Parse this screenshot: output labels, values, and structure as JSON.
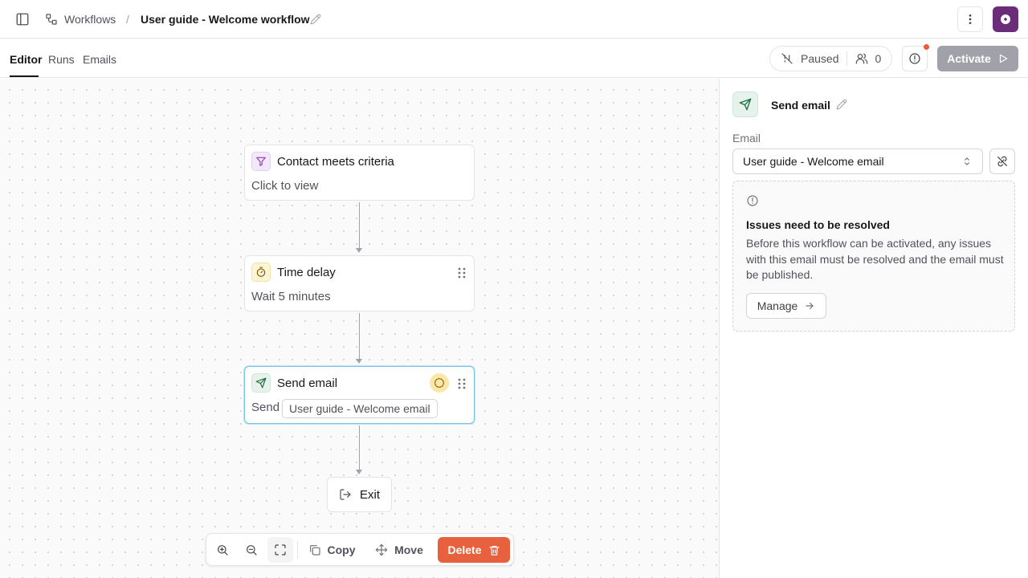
{
  "header": {
    "breadcrumb_root": "Workflows",
    "separator": "/",
    "workflow_name": "User guide - Welcome workflow"
  },
  "tabs": [
    {
      "label": "Editor",
      "active": true
    },
    {
      "label": "Runs",
      "active": false
    },
    {
      "label": "Emails",
      "active": false
    }
  ],
  "status": {
    "state_label": "Paused",
    "participants_count": "0",
    "activate_label": "Activate"
  },
  "canvas": {
    "trigger": {
      "title": "Contact meets criteria",
      "subtitle": "Click to view"
    },
    "delay": {
      "title": "Time delay",
      "subtitle": "Wait 5 minutes"
    },
    "send": {
      "title": "Send email",
      "prefix": "Send",
      "email_chip": "User guide - Welcome email"
    },
    "exit": {
      "label": "Exit"
    }
  },
  "toolbar": {
    "copy_label": "Copy",
    "move_label": "Move",
    "delete_label": "Delete"
  },
  "panel": {
    "title": "Send email",
    "email_field_label": "Email",
    "email_selected": "User guide - Welcome email",
    "issue_title": "Issues need to be resolved",
    "issue_text": "Before this workflow can be activated, any issues with this email must be resolved and the email must be published.",
    "manage_label": "Manage"
  },
  "colors": {
    "accent_delete": "#e8613f",
    "activate_disabled": "#a1a1aa",
    "avatar": "#6b2d7a",
    "alert_dot": "#ef5a3c",
    "selected_node_border": "#7dc3e8"
  },
  "icons": [
    "sidebar-toggle-icon",
    "workflow-icon",
    "pencil-icon",
    "more-vertical-icon",
    "avatar-logo-icon",
    "pause-off-icon",
    "users-icon",
    "alert-circle-icon",
    "play-icon",
    "filter-icon",
    "timer-icon",
    "send-icon",
    "drag-handle-icon",
    "warning-add-icon",
    "exit-icon",
    "zoom-in-icon",
    "zoom-out-icon",
    "fit-view-icon",
    "copy-icon",
    "move-icon",
    "trash-icon",
    "chevron-updown-icon",
    "unlink-icon",
    "info-icon",
    "arrow-right-icon"
  ]
}
